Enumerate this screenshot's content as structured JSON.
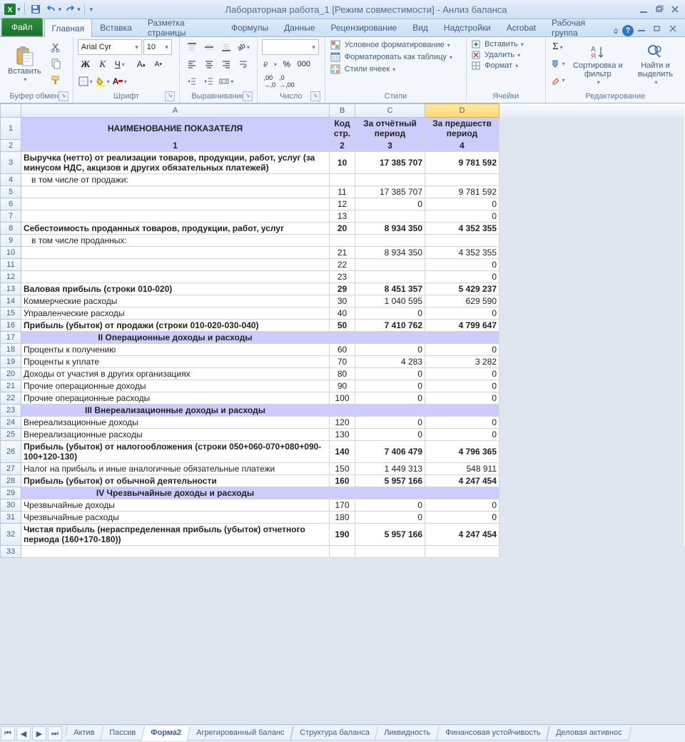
{
  "titlebar": {
    "title": "Лабораторная работа_1  [Режим совместимости]  -  Анлиз баланса",
    "icons": {
      "excel": "X",
      "save": "save",
      "undo": "undo",
      "redo": "redo"
    }
  },
  "tabs": {
    "file": "Файл",
    "items": [
      "Главная",
      "Вставка",
      "Разметка страницы",
      "Формулы",
      "Данные",
      "Рецензирование",
      "Вид",
      "Надстройки",
      "Acrobat",
      "Рабочая группа"
    ],
    "active_index": 0
  },
  "ribbon": {
    "clipboard": {
      "paste": "Вставить",
      "label": "Буфер обмена"
    },
    "font": {
      "family": "Arial Cyr",
      "size": "10",
      "label": "Шрифт"
    },
    "alignment": {
      "label": "Выравнивание"
    },
    "number": {
      "label": "Число"
    },
    "styles": {
      "cond_fmt": "Условное форматирование",
      "fmt_table": "Форматировать как таблицу",
      "cell_styles": "Стили ячеек",
      "label": "Стили"
    },
    "cells": {
      "insert": "Вставить",
      "delete": "Удалить",
      "format": "Формат",
      "label": "Ячейки"
    },
    "editing": {
      "sort": "Сортировка и фильтр",
      "find": "Найти и выделить",
      "label": "Редактирование"
    }
  },
  "columns": [
    "A",
    "B",
    "C",
    "D"
  ],
  "header_row": {
    "a": "НАИМЕНОВАНИЕ ПОКАЗАТЕЛЯ",
    "b": "Код стр.",
    "c": "За отчётный период",
    "d": "За предшеств период"
  },
  "header_row2": {
    "a": "1",
    "b": "2",
    "c": "3",
    "d": "4"
  },
  "rows": [
    {
      "n": 3,
      "bold": true,
      "wrap": true,
      "a": "Выручка (нетто) от реализации товаров, продукции, работ, услуг (за минусом НДС, акцизов и других обязательных платежей)",
      "b": "10",
      "c": "17 385 707",
      "d": "9 781 592"
    },
    {
      "n": 4,
      "indent": true,
      "a": "в том числе от продажи:",
      "b": "",
      "c": "",
      "d": ""
    },
    {
      "n": 5,
      "a": "",
      "b": "11",
      "c": "17 385 707",
      "d": "9 781 592"
    },
    {
      "n": 6,
      "a": "",
      "b": "12",
      "c": "0",
      "d": "0"
    },
    {
      "n": 7,
      "a": "",
      "b": "13",
      "c": "",
      "d": "0"
    },
    {
      "n": 8,
      "bold": true,
      "a": "Себестоимость проданных товаров, продукции, работ, услуг",
      "b": "20",
      "c": "8 934 350",
      "d": "4 352 355"
    },
    {
      "n": 9,
      "indent": true,
      "a": "в том числе проданных:",
      "b": "",
      "c": "",
      "d": ""
    },
    {
      "n": 10,
      "a": "",
      "b": "21",
      "c": "8 934 350",
      "d": "4 352 355"
    },
    {
      "n": 11,
      "a": "",
      "b": "22",
      "c": "",
      "d": "0"
    },
    {
      "n": 12,
      "a": "",
      "b": "23",
      "c": "",
      "d": "0"
    },
    {
      "n": 13,
      "bold": true,
      "a": "Валовая прибыль (строки 010-020)",
      "b": "29",
      "c": "8 451 357",
      "d": "5 429 237"
    },
    {
      "n": 14,
      "a": "Коммерческие расходы",
      "b": "30",
      "c": "1 040 595",
      "d": "629 590"
    },
    {
      "n": 15,
      "a": "Управленческие расходы",
      "b": "40",
      "c": "0",
      "d": "0"
    },
    {
      "n": 16,
      "bold": true,
      "a": "Прибыль (убыток) от продажи (строки 010-020-030-040)",
      "b": "50",
      "c": "7 410 762",
      "d": "4 799 647"
    },
    {
      "n": 17,
      "section": true,
      "a": "II Операционные доходы и расходы",
      "b": "",
      "c": "",
      "d": ""
    },
    {
      "n": 18,
      "a": "Проценты к получению",
      "b": "60",
      "c": "0",
      "d": "0"
    },
    {
      "n": 19,
      "a": "Проценты к уплате",
      "b": "70",
      "c": "4 283",
      "d": "3 282"
    },
    {
      "n": 20,
      "a": "Доходы от участия в других организациях",
      "b": "80",
      "c": "0",
      "d": "0"
    },
    {
      "n": 21,
      "a": "Прочие операционные доходы",
      "b": "90",
      "c": "0",
      "d": "0"
    },
    {
      "n": 22,
      "a": "Прочие операционные расходы",
      "b": "100",
      "c": "0",
      "d": "0"
    },
    {
      "n": 23,
      "section": true,
      "a": "III Внереализационные доходы и расходы",
      "b": "",
      "c": "",
      "d": ""
    },
    {
      "n": 24,
      "a": "Внереализационные доходы",
      "b": "120",
      "c": "0",
      "d": "0"
    },
    {
      "n": 25,
      "a": "Внереализационные расходы",
      "b": "130",
      "c": "0",
      "d": "0"
    },
    {
      "n": 26,
      "bold": true,
      "wrap": true,
      "a": "Прибыль (убыток) от налогообложения (строки 050+060-070+080+090-100+120-130)",
      "b": "140",
      "c": "7 406 479",
      "d": "4 796 365"
    },
    {
      "n": 27,
      "a": "Налог на прибыль и иные аналогичные обязательные платежи",
      "b": "150",
      "c": "1 449 313",
      "d": "548 911"
    },
    {
      "n": 28,
      "bold": true,
      "a": "Прибыль (убыток) от обычной деятельности",
      "b": "160",
      "c": "5 957 166",
      "d": "4 247 454"
    },
    {
      "n": 29,
      "section": true,
      "a": "IV Чрезвычайные доходы и расходы",
      "b": "",
      "c": "",
      "d": ""
    },
    {
      "n": 30,
      "a": "Чрезвычайные доходы",
      "b": "170",
      "c": "0",
      "d": "0"
    },
    {
      "n": 31,
      "a": "Чрезвычайные расходы",
      "b": "180",
      "c": "0",
      "d": "0"
    },
    {
      "n": 32,
      "bold": true,
      "wrap": true,
      "a": "Чистая прибыль (нераспределенная прибыль (убыток) отчетного периода (160+170-180))",
      "b": "190",
      "c": "5 957 166",
      "d": "4 247 454"
    },
    {
      "n": 33,
      "blank": true,
      "a": "",
      "b": "",
      "c": "",
      "d": ""
    }
  ],
  "sheets": {
    "items": [
      "Актив",
      "Пассив",
      "Форма2",
      "Агрегированный баланс",
      "Структура баланса",
      "Ликвидность",
      "Финансовая устойчивость",
      "Деловая активнос"
    ],
    "active_index": 2
  }
}
